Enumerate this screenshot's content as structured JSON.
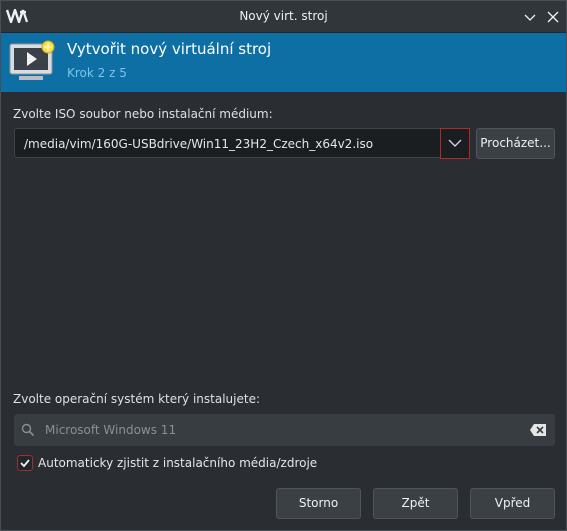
{
  "window": {
    "title": "Nový virt. stroj"
  },
  "banner": {
    "title": "Vytvořit nový virtuální stroj",
    "step": "Krok 2 z 5"
  },
  "iso": {
    "label": "Zvolte ISO soubor nebo instalační médium:",
    "value": "/media/vim/160G-USBdrive/Win11_23H2_Czech_x64v2.iso",
    "browse_label": "Procházet..."
  },
  "os": {
    "label": "Zvolte operační systém který instalujete:",
    "placeholder": "Microsoft Windows 11"
  },
  "autodetect": {
    "label": "Automaticky zjistit z instalačního média/zdroje",
    "checked": true
  },
  "footer": {
    "cancel_label": "Storno",
    "back_label": "Zpět",
    "next_label": "Vpřed"
  },
  "colors": {
    "banner": "#0e6fa5",
    "accent_red": "#b02a2a"
  }
}
